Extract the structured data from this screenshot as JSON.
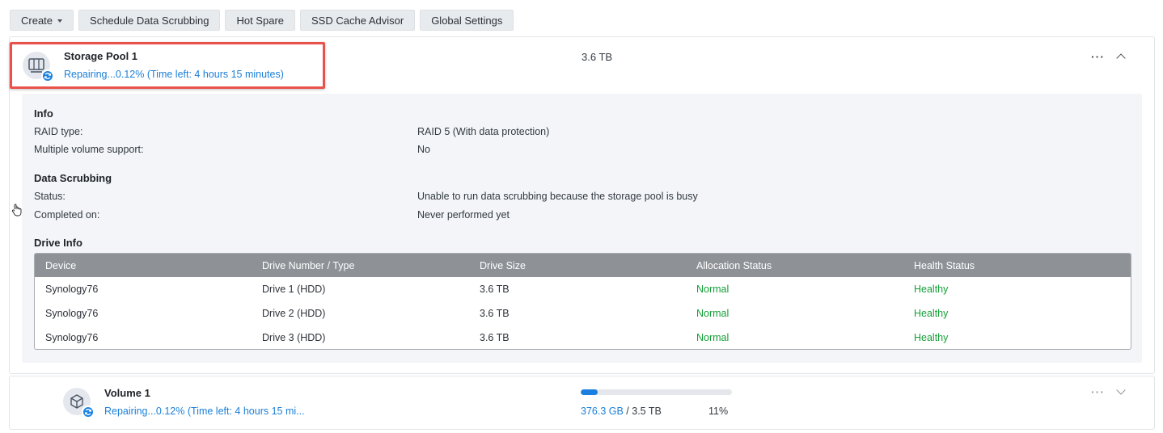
{
  "toolbar": {
    "create_label": "Create",
    "schedule_label": "Schedule Data Scrubbing",
    "hot_spare_label": "Hot Spare",
    "ssd_cache_label": "SSD Cache Advisor",
    "global_settings_label": "Global Settings"
  },
  "pool": {
    "name": "Storage Pool 1",
    "status": "Repairing...0.12% (Time left: 4 hours 15 minutes)",
    "capacity": "3.6 TB",
    "icon": "storage-pool-icon",
    "more_label": "···",
    "info": {
      "title": "Info",
      "raid_type_label": "RAID type:",
      "raid_type_value": "RAID 5 (With data protection)",
      "multi_volume_label": "Multiple volume support:",
      "multi_volume_value": "No"
    },
    "scrubbing": {
      "title": "Data Scrubbing",
      "status_label": "Status:",
      "status_value": "Unable to run data scrubbing because the storage pool is busy",
      "completed_label": "Completed on:",
      "completed_value": "Never performed yet"
    },
    "drive_info": {
      "title": "Drive Info",
      "columns": [
        "Device",
        "Drive Number / Type",
        "Drive Size",
        "Allocation Status",
        "Health Status"
      ],
      "rows": [
        {
          "device": "Synology76",
          "drive": "Drive 1 (HDD)",
          "size": "3.6 TB",
          "allocation": "Normal",
          "health": "Healthy"
        },
        {
          "device": "Synology76",
          "drive": "Drive 2 (HDD)",
          "size": "3.6 TB",
          "allocation": "Normal",
          "health": "Healthy"
        },
        {
          "device": "Synology76",
          "drive": "Drive 3 (HDD)",
          "size": "3.6 TB",
          "allocation": "Normal",
          "health": "Healthy"
        }
      ]
    }
  },
  "volume": {
    "name": "Volume 1",
    "status": "Repairing...0.12% (Time left: 4 hours 15 mi...",
    "used": "376.3 GB",
    "total": " / 3.5 TB",
    "percent": "11%",
    "usage_fraction": 0.11,
    "icon": "volume-icon",
    "more_label": "···"
  },
  "colors": {
    "accent": "#1b82e2",
    "healthy": "#14a037",
    "highlight": "#e8524a",
    "table_header": "#8e9297"
  }
}
